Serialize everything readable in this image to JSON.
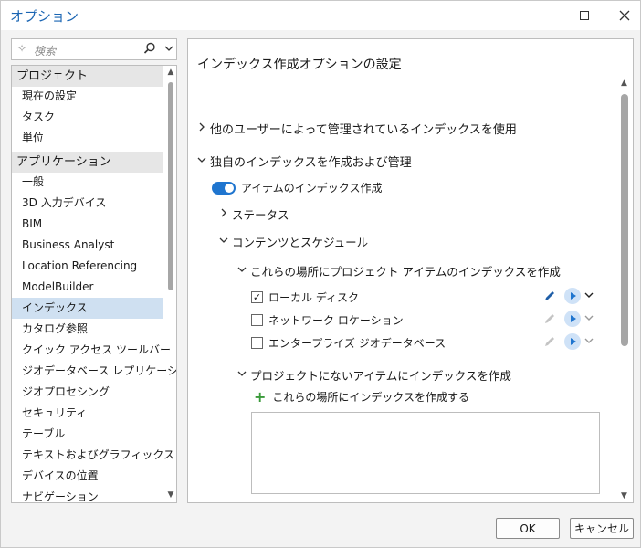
{
  "window": {
    "title": "オプション"
  },
  "search": {
    "placeholder": "検索"
  },
  "nav": {
    "items": [
      {
        "label": "プロジェクト",
        "type": "header"
      },
      {
        "label": "現在の設定",
        "type": "item"
      },
      {
        "label": "タスク",
        "type": "item"
      },
      {
        "label": "単位",
        "type": "item"
      },
      {
        "label": "アプリケーション",
        "type": "header"
      },
      {
        "label": "一般",
        "type": "item"
      },
      {
        "label": "3D 入力デバイス",
        "type": "item"
      },
      {
        "label": "BIM",
        "type": "item"
      },
      {
        "label": "Business Analyst",
        "type": "item"
      },
      {
        "label": "Location Referencing",
        "type": "item"
      },
      {
        "label": "ModelBuilder",
        "type": "item"
      },
      {
        "label": "インデックス",
        "type": "selected"
      },
      {
        "label": "カタログ参照",
        "type": "item"
      },
      {
        "label": "クイック アクセス ツールバー",
        "type": "item"
      },
      {
        "label": "ジオデータベース レプリケーション",
        "type": "item"
      },
      {
        "label": "ジオプロセシング",
        "type": "item"
      },
      {
        "label": "セキュリティ",
        "type": "item"
      },
      {
        "label": "テーブル",
        "type": "item"
      },
      {
        "label": "テキストおよびグラフィックス",
        "type": "item"
      },
      {
        "label": "デバイスの位置",
        "type": "item"
      },
      {
        "label": "ナビゲーション",
        "type": "item"
      }
    ]
  },
  "panel": {
    "title": "インデックス作成オプションの設定",
    "section_others": "他のユーザーによって管理されているインデックスを使用",
    "section_own": "独自のインデックスを作成および管理",
    "toggle_label": "アイテムのインデックス作成",
    "status_label": "ステータス",
    "content_label": "コンテンツとスケジュール",
    "project_locations_label": "これらの場所にプロジェクト アイテムのインデックスを作成",
    "locations": [
      {
        "label": "ローカル ディスク",
        "checked": true
      },
      {
        "label": "ネットワーク ロケーション",
        "checked": false
      },
      {
        "label": "エンタープライズ ジオデータベース",
        "checked": false
      }
    ],
    "non_project_label": "プロジェクトにないアイテムにインデックスを作成",
    "add_location_label": "これらの場所にインデックスを作成する"
  },
  "buttons": {
    "ok": "OK",
    "cancel": "キャンセル"
  },
  "colors": {
    "accent": "#1f75cf",
    "title": "#1a65b3",
    "selected": "#cfe0f1",
    "plus": "#3a9a3a"
  }
}
